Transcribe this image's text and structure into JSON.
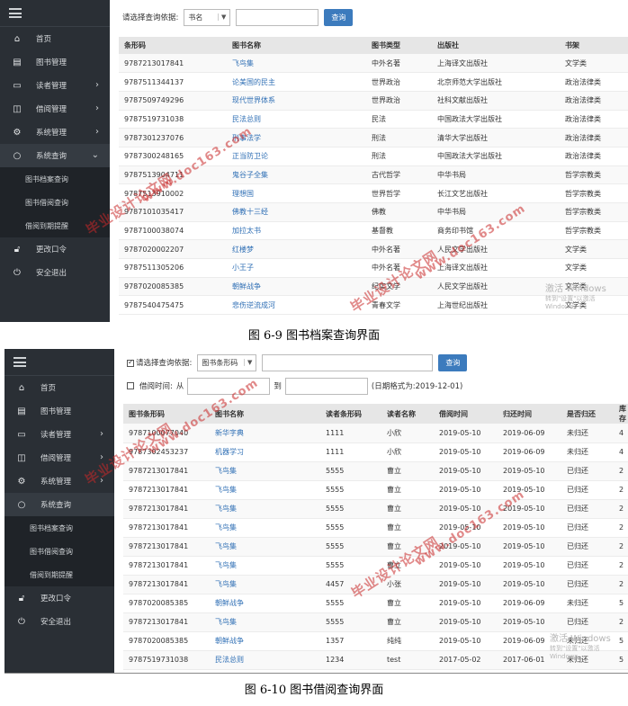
{
  "sidebar": {
    "items": [
      {
        "label": "首页",
        "icon": "home-icon"
      },
      {
        "label": "图书管理",
        "icon": "book-manage-icon"
      },
      {
        "label": "读者管理",
        "icon": "reader-card-icon"
      },
      {
        "label": "借阅管理",
        "icon": "open-book-icon"
      },
      {
        "label": "系统管理",
        "icon": "gear-icon"
      },
      {
        "label": "系统查询",
        "icon": "search-icon"
      }
    ],
    "sub_items": [
      "图书档案查询",
      "图书借阅查询",
      "借阅到期提醒"
    ],
    "bottom_items": [
      {
        "label": "更改口令",
        "icon": "lock-icon"
      },
      {
        "label": "安全退出",
        "icon": "power-icon"
      }
    ]
  },
  "screen1": {
    "query_label": "请选择查询依据:",
    "select_value": "书名",
    "search_button": "查询",
    "columns": [
      "条形码",
      "图书名称",
      "图书类型",
      "出版社",
      "书架"
    ],
    "rows": [
      [
        "9787213017841",
        "飞鸟集",
        "中外名著",
        "上海译文出版社",
        "文学类"
      ],
      [
        "9787511344137",
        "论美国的民主",
        "世界政治",
        "北京师范大学出版社",
        "政治法律类"
      ],
      [
        "9787509749296",
        "现代世界体系",
        "世界政治",
        "社科文献出版社",
        "政治法律类"
      ],
      [
        "9787519731038",
        "民法总则",
        "民法",
        "中国政法大学出版社",
        "政治法律类"
      ],
      [
        "9787301237076",
        "刑事法学",
        "刑法",
        "清华大学出版社",
        "政治法律类"
      ],
      [
        "9787300248165",
        "正当防卫论",
        "刑法",
        "中国政法大学出版社",
        "政治法律类"
      ],
      [
        "9787513904711",
        "鬼谷子全集",
        "古代哲学",
        "中华书局",
        "哲学宗教类"
      ],
      [
        "9787513910002",
        "理想国",
        "世界哲学",
        "长江文艺出版社",
        "哲学宗教类"
      ],
      [
        "9787101035417",
        "佛教十三经",
        "佛教",
        "中华书局",
        "哲学宗教类"
      ],
      [
        "9787100038074",
        "加拉太书",
        "基督教",
        "商务印书馆",
        "哲学宗教类"
      ],
      [
        "9787020002207",
        "红楼梦",
        "中外名著",
        "人民文学出版社",
        "文学类"
      ],
      [
        "9787511305206",
        "小王子",
        "中外名著",
        "上海译文出版社",
        "文学类"
      ],
      [
        "9787020085385",
        "朝鲜战争",
        "纪实文学",
        "人民文学出版社",
        "文学类"
      ],
      [
        "9787540475475",
        "悲伤逆流成河",
        "青春文学",
        "上海世纪出版社",
        "文学类"
      ]
    ]
  },
  "screen2": {
    "query_label": "请选择查询依据:",
    "select_value": "图书条形码",
    "search_button": "查询",
    "date_label": "借阅时间:",
    "from_label": "从",
    "to_label": "到",
    "date_hint": "(日期格式为:2019-12-01)",
    "columns": [
      "图书条形码",
      "图书名称",
      "读者条形码",
      "读者名称",
      "借阅时间",
      "归还时间",
      "是否归还",
      "库存"
    ],
    "rows": [
      [
        "9787100077040",
        "新华字典",
        "1111",
        "小欣",
        "2019-05-10",
        "2019-06-09",
        "未归还",
        "4"
      ],
      [
        "9787302453237",
        "机器学习",
        "1111",
        "小欣",
        "2019-05-10",
        "2019-06-09",
        "未归还",
        "4"
      ],
      [
        "9787213017841",
        "飞鸟集",
        "5555",
        "曹立",
        "2019-05-10",
        "2019-05-10",
        "已归还",
        "2"
      ],
      [
        "9787213017841",
        "飞鸟集",
        "5555",
        "曹立",
        "2019-05-10",
        "2019-05-10",
        "已归还",
        "2"
      ],
      [
        "9787213017841",
        "飞鸟集",
        "5555",
        "曹立",
        "2019-05-10",
        "2019-05-10",
        "已归还",
        "2"
      ],
      [
        "9787213017841",
        "飞鸟集",
        "5555",
        "曹立",
        "2019-05-10",
        "2019-05-10",
        "已归还",
        "2"
      ],
      [
        "9787213017841",
        "飞鸟集",
        "5555",
        "曹立",
        "2019-05-10",
        "2019-05-10",
        "已归还",
        "2"
      ],
      [
        "9787213017841",
        "飞鸟集",
        "5555",
        "曹立",
        "2019-05-10",
        "2019-05-10",
        "已归还",
        "2"
      ],
      [
        "9787213017841",
        "飞鸟集",
        "4457",
        "小张",
        "2019-05-10",
        "2019-05-10",
        "已归还",
        "2"
      ],
      [
        "9787020085385",
        "朝鲜战争",
        "5555",
        "曹立",
        "2019-05-10",
        "2019-06-09",
        "未归还",
        "5"
      ],
      [
        "9787213017841",
        "飞鸟集",
        "5555",
        "曹立",
        "2019-05-10",
        "2019-05-10",
        "已归还",
        "2"
      ],
      [
        "9787020085385",
        "朝鲜战争",
        "1357",
        "纯纯",
        "2019-05-10",
        "2019-06-09",
        "未归还",
        "5"
      ],
      [
        "9787519731038",
        "民法总则",
        "1234",
        "test",
        "2017-05-02",
        "2017-06-01",
        "未归还",
        "5"
      ]
    ]
  },
  "captions": {
    "fig1": "图 6-9  图书档案查询界面",
    "fig2": "图 6-10  图书借阅查询界面"
  },
  "watermark": {
    "text": "毕业设计论文网",
    "url": "www.doc163.com"
  },
  "activation": {
    "line1": "激活 Windows",
    "line2": "转到\"设置\"以激活 Windows。"
  }
}
